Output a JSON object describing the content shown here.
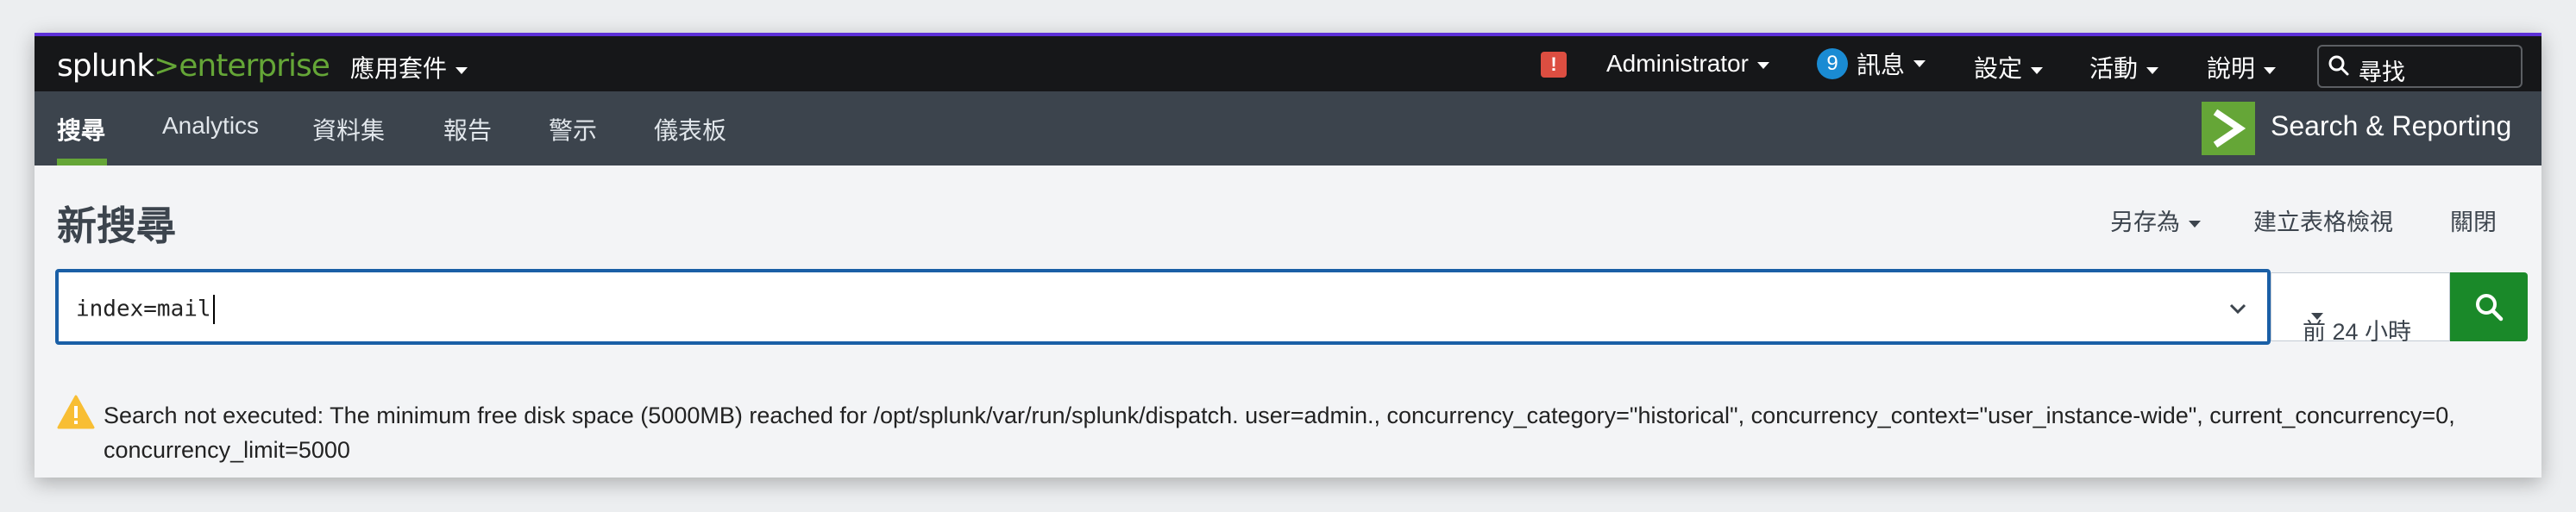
{
  "header": {
    "logo_main": "splunk",
    "logo_gt": ">",
    "logo_product": "enterprise",
    "apps_menu": "應用套件",
    "alert_icon_text": "!",
    "user": "Administrator",
    "messages_count": "9",
    "messages": "訊息",
    "settings": "設定",
    "activity": "活動",
    "help": "說明",
    "search_placeholder": "尋找"
  },
  "app_nav": {
    "tabs": [
      {
        "label": "搜尋"
      },
      {
        "label": "Analytics"
      },
      {
        "label": "資料集"
      },
      {
        "label": "報告"
      },
      {
        "label": "警示"
      },
      {
        "label": "儀表板"
      }
    ],
    "app_title": "Search & Reporting"
  },
  "page": {
    "title": "新搜尋",
    "save_as": "另存為",
    "create_table_view": "建立表格檢視",
    "close": "關閉"
  },
  "search": {
    "query": "index=mail",
    "time_range": "前 24 小時"
  },
  "message": {
    "text": "Search not executed: The minimum free disk space (5000MB) reached for /opt/splunk/var/run/splunk/dispatch. user=admin., concurrency_category=\"historical\", concurrency_context=\"user_instance-wide\", current_concurrency=0, concurrency_limit=5000"
  },
  "colors": {
    "topbar": "#161719",
    "appbar": "#3c444d",
    "accent_green": "#65a637",
    "search_button": "#1a8929",
    "focus_border": "#1a5fa6",
    "warning": "#f8be34",
    "alert": "#dc4e41"
  },
  "icons": [
    "alert-icon",
    "search-icon",
    "app-logo-icon",
    "chevron-down-icon",
    "warning-icon"
  ]
}
